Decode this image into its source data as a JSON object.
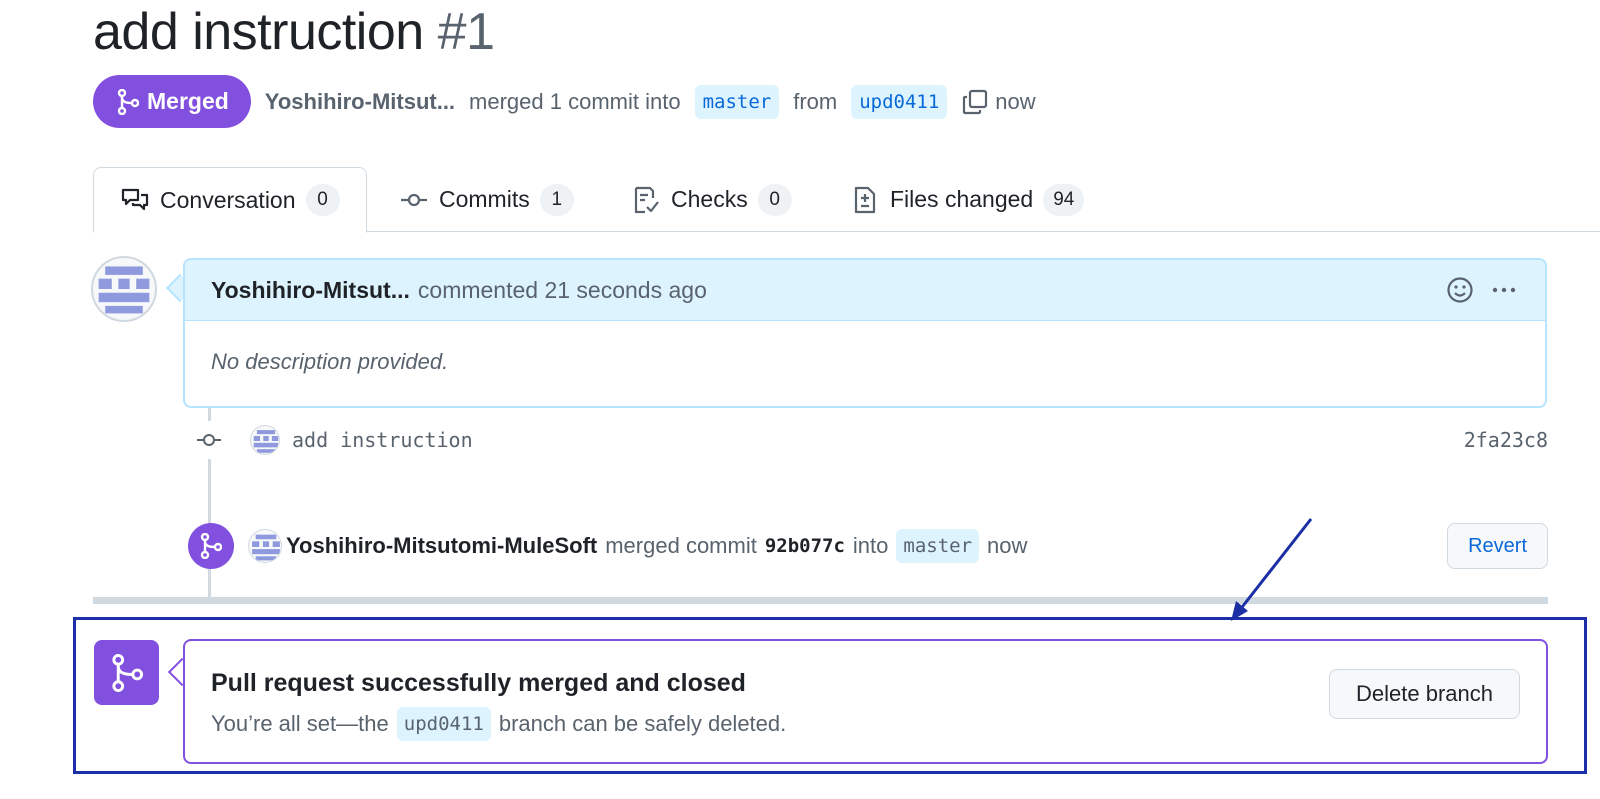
{
  "pr": {
    "title": "add instruction",
    "number": "#1",
    "state": "Merged",
    "author": "Yoshihiro-Mitsut...",
    "merged_text": "merged 1 commit into",
    "base_branch": "master",
    "from_text": "from",
    "head_branch": "upd0411",
    "time": "now"
  },
  "tabs": [
    {
      "label": "Conversation",
      "count": "0",
      "icon": "comment-discussion-icon"
    },
    {
      "label": "Commits",
      "count": "1",
      "icon": "git-commit-icon"
    },
    {
      "label": "Checks",
      "count": "0",
      "icon": "checklist-icon"
    },
    {
      "label": "Files changed",
      "count": "94",
      "icon": "file-diff-icon"
    }
  ],
  "comment": {
    "author": "Yoshihiro-Mitsut...",
    "meta": "commented 21 seconds ago",
    "body": "No description provided."
  },
  "commit": {
    "message": "add instruction",
    "sha": "2fa23c8"
  },
  "merge_event": {
    "author": "Yoshihiro-Mitsutomi-MuleSoft",
    "text1": "merged commit",
    "sha": "92b077c",
    "text2": "into",
    "branch": "master",
    "time": "now",
    "revert_label": "Revert"
  },
  "merge_box": {
    "heading": "Pull request successfully merged and closed",
    "sub_before": "You’re all set—the",
    "branch": "upd0411",
    "sub_after": "branch can be safely deleted.",
    "delete_label": "Delete branch"
  },
  "colors": {
    "merged_purple": "#8250df",
    "link_blue": "#0969da",
    "annotation_blue": "#1d2fa6"
  }
}
